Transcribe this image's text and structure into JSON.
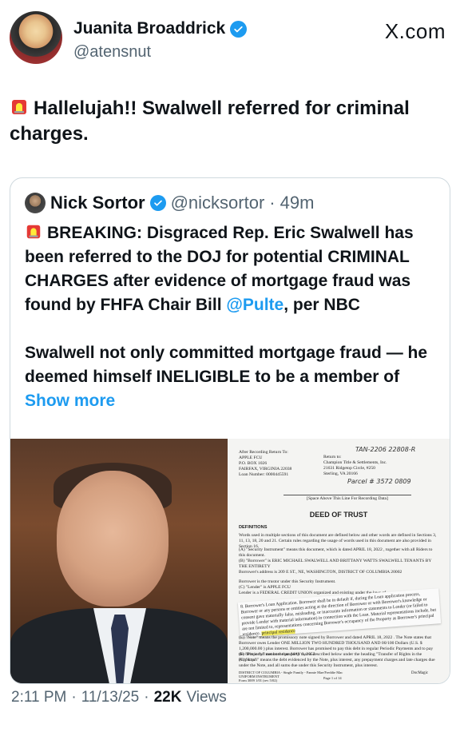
{
  "author": {
    "display_name": "Juanita Broaddrick",
    "handle": "@atensnut",
    "verified_icon": "verified-badge-icon"
  },
  "brand": "X.com",
  "tweet": {
    "text": "Hallelujah!!   Swalwell  referred for criminal charges.",
    "emoji_icon": "police-siren-icon"
  },
  "quoted": {
    "display_name": "Nick Sortor",
    "handle": "@nicksortor",
    "separator": "·",
    "time": "49m",
    "text_before_link": "BREAKING: Disgraced Rep. Eric Swalwell has been referred to the DOJ for potential CRIMINAL CHARGES after evidence of mortgage fraud was found by FHFA Chair Bill ",
    "mention": "@Pulte",
    "text_after_link": ", per NBC",
    "text_para2": "Swalwell not only committed mortgage fraud — he deemed himself INELIGIBLE to be a member of ",
    "show_more": "Show more",
    "document": {
      "return_to": "After Recording Return To:\nAPPLE FCU\nP.O. BOX 1026\nFAIRFAX, VIRGINIA 22038\nLoan Number: 0000445591",
      "handwritten_no": "TAN-2206 22808-R",
      "prepared_by": "Return to:\nChampion Title & Settlements, Inc.\n21631 Ridgetop Circle, #250\nSterling, VA 20166",
      "parcel": "Parcel # 3572 0809",
      "space_note": "[Space Above This Line For Recording Data]",
      "title": "DEED OF TRUST",
      "definitions_label": "DEFINITIONS",
      "definitions_text": "Words used in multiple sections of this document are defined below and other words are defined in Sections 3, 11, 13, 18, 20 and 21. Certain rules regarding the usage of words used in this document are also provided in Section 16.",
      "a_line": "(A) \"Security Instrument\" means this document, which is dated APRIL 18, 2022 , together with all Riders to this document.",
      "b_line": "(B) \"Borrower\" is ERIC MICHAEL SWALWELL AND BRITTANY WATTS SWALWELL TENANTS BY THE ENTIRETY",
      "address_line": "Borrower's address is 209 E ST., NE, WASHINGTON, DISTRICT OF COLUMBIA 20002",
      "trustee_line": "Borrower is the trustor under this Security Instrument.",
      "c_line": "(C) \"Lender\" is APPLE FCU",
      "lender_line": "Lender is a FEDERAL CREDIT UNION organized and existing under the laws of",
      "strip_text": "8. Borrower's Loan Application. Borrower shall be in default if, during the Loan application process, Borrower or any persons or entities acting at the direction of Borrower or with Borrower's knowledge or consent gave materially false, misleading, or inaccurate information or statements to Lender (or failed to provide Lender with material information) in connection with the Loan. Material representations include, but are not limited to, representations concerning Borrower's occupancy of the Property as Borrower's principal residence.",
      "highlighted": "principal residence",
      "note_line": "(E) \"Note\" means the promissory note signed by Borrower and dated APRIL 18, 2022 . The Note states that Borrower owes Lender ONE MILLION TWO HUNDRED THOUSAND AND 00/100 Dollars (U.S. $ 1,200,000.00 ) plus interest. Borrower has promised to pay this debt in regular Periodic Payments and to pay the debt in full not later than MAY 1, 2052",
      "f_line": "(F) \"Property\" means the property that is described below under the heading \"Transfer of Rights in the Property.\"",
      "g_line": "(G) \"Loan\" means the debt evidenced by the Note, plus interest, any prepayment charges and late charges due under the Note, and all sums due under this Security Instrument, plus interest.",
      "footer_left": "DISTRICT OF COLUMBIA - Single Family - Fannie Mae/Freddie Mac UNIFORM INSTRUMENT\nForm 3009 1/01 (rev 5/02)",
      "footer_page": "Page 1 of 14",
      "footer_right": "DocMagic"
    }
  },
  "footer": {
    "time": "2:11 PM",
    "dot1": "·",
    "date": "11/13/25",
    "dot2": "·",
    "views_count": "22K",
    "views_label": "Views"
  }
}
